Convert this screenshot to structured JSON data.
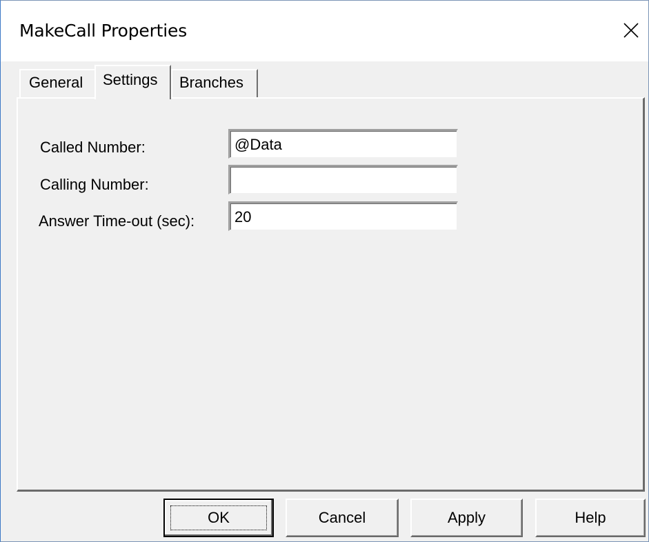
{
  "window": {
    "title": "MakeCall Properties"
  },
  "tabs": [
    {
      "label": "General",
      "active": false
    },
    {
      "label": "Settings",
      "active": true
    },
    {
      "label": "Branches",
      "active": false
    }
  ],
  "settings": {
    "called_number": {
      "label": "Called Number:",
      "value": "@Data"
    },
    "calling_number": {
      "label": "Calling Number:",
      "value": ""
    },
    "answer_timeout": {
      "label": "Answer Time-out (sec):",
      "value": "20"
    }
  },
  "buttons": {
    "ok": "OK",
    "cancel": "Cancel",
    "apply": "Apply",
    "help": "Help"
  },
  "icons": {
    "close": "close-icon"
  }
}
